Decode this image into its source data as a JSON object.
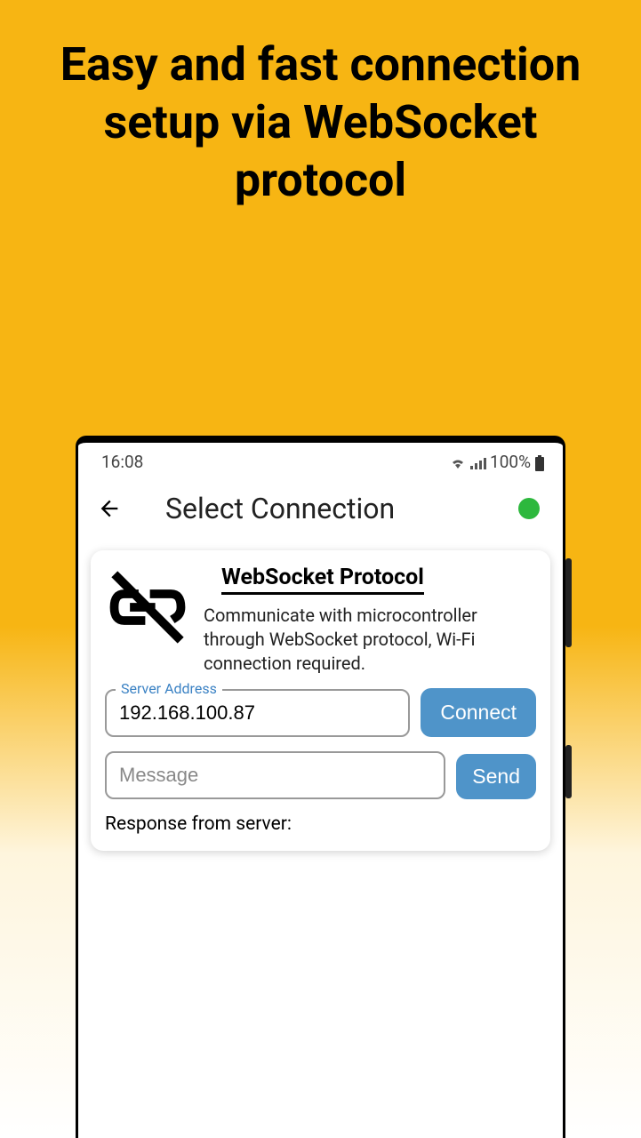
{
  "promo": {
    "title": "Easy and fast connection setup via WebSocket protocol"
  },
  "statusbar": {
    "time": "16:08",
    "battery_pct": "100%"
  },
  "appbar": {
    "title": "Select Connection"
  },
  "card": {
    "title": "WebSocket Protocol",
    "description": "Communicate with microcontroller through WebSocket protocol, Wi-Fi connection required.",
    "server_label": "Server Address",
    "server_value": "192.168.100.87",
    "connect_label": "Connect",
    "message_placeholder": "Message",
    "message_value": "",
    "send_label": "Send",
    "response_label": "Response from server:"
  }
}
